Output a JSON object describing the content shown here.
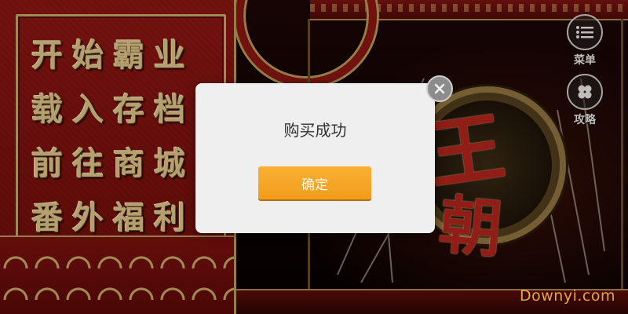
{
  "left_menu": {
    "items": [
      {
        "label": "开始霸业"
      },
      {
        "label": "载入存档"
      },
      {
        "label": "前往商城"
      },
      {
        "label": "番外福利"
      }
    ]
  },
  "side_buttons": {
    "menu": {
      "label": "菜单",
      "icon": "list-icon"
    },
    "guide": {
      "label": "攻略",
      "icon": "guide-icon"
    }
  },
  "title_art": {
    "chars": [
      "王",
      "朝"
    ]
  },
  "dialog": {
    "message": "购买成功",
    "confirm_label": "确定",
    "close_icon": "close-icon"
  },
  "watermark": "Downyi.com",
  "colors": {
    "panel_red": "#7a110e",
    "gold": "#c5a868",
    "button_orange": "#f4a324",
    "dialog_bg": "#efefef",
    "watermark": "#f0a542"
  }
}
